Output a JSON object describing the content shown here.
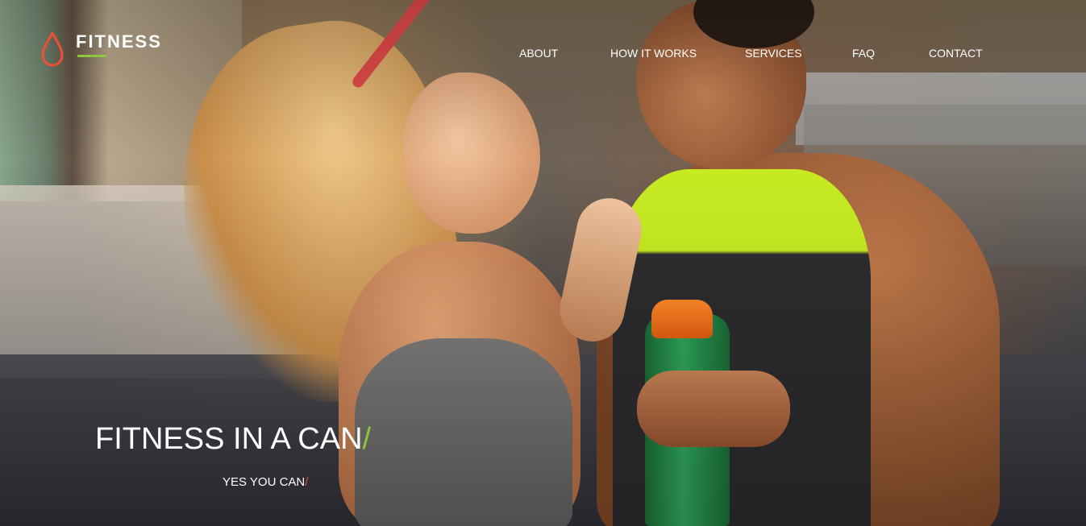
{
  "logo": {
    "text": "FITNESS",
    "icon": "drop-icon",
    "icon_color": "#e8503a",
    "underline_color": "#8dc63f"
  },
  "nav": {
    "items": [
      {
        "label": "ABOUT"
      },
      {
        "label": "HOW IT WORKS"
      },
      {
        "label": "SERVICES"
      },
      {
        "label": "FAQ"
      },
      {
        "label": "CONTACT"
      }
    ]
  },
  "hero": {
    "title": "FITNESS IN A CAN",
    "title_suffix": "/",
    "subtitle": "YES YOU CAN",
    "subtitle_suffix": "/",
    "accent_green": "#8dc63f",
    "accent_red": "#e24a4a"
  }
}
